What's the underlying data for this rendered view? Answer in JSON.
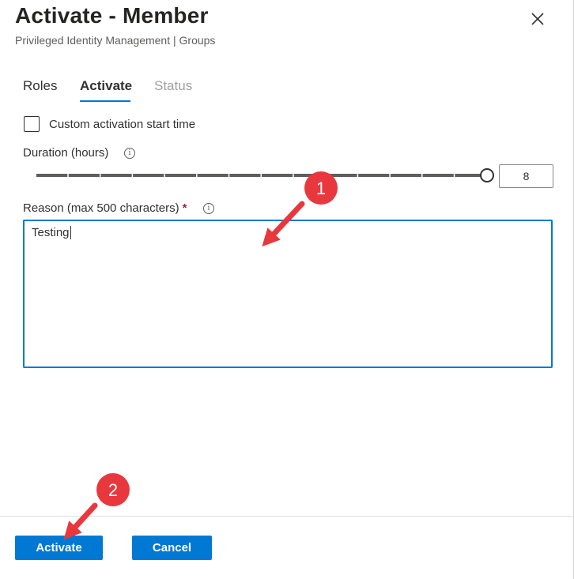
{
  "dialog": {
    "title": "Activate - Member",
    "subtitle": "Privileged Identity Management | Groups",
    "close_icon": "close-icon"
  },
  "tabs": [
    {
      "label": "Roles",
      "state": "normal"
    },
    {
      "label": "Activate",
      "state": "selected"
    },
    {
      "label": "Status",
      "state": "disabled"
    }
  ],
  "custom_start": {
    "label": "Custom activation start time",
    "checked": false
  },
  "duration": {
    "label": "Duration (hours)",
    "info_icon": "info-icon",
    "value": "8",
    "slider_min": 0,
    "slider_max": 8,
    "slider_value": 8
  },
  "reason": {
    "label": "Reason (max 500 characters)",
    "required_mark": "*",
    "info_icon": "info-icon",
    "value": "Testing"
  },
  "footer": {
    "activate_label": "Activate",
    "cancel_label": "Cancel"
  },
  "annotations": [
    {
      "number": "1",
      "color": "#e8383d"
    },
    {
      "number": "2",
      "color": "#e8383d"
    }
  ],
  "colors": {
    "accent": "#0078d4",
    "annotation": "#e8383d",
    "required": "#a4262c"
  }
}
